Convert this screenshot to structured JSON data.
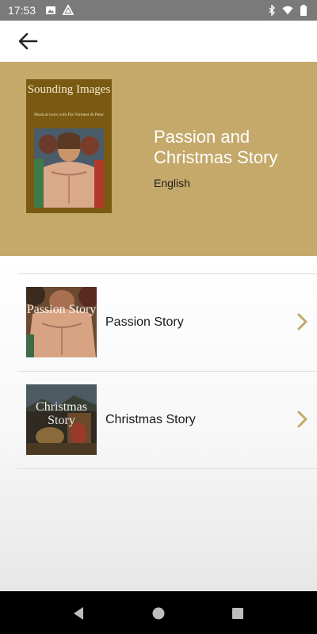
{
  "status_bar": {
    "time": "17:53",
    "left_icons": [
      "image-icon",
      "drive-icon"
    ],
    "right_icons": [
      "bluetooth-icon",
      "wifi-icon",
      "battery-icon"
    ]
  },
  "app_bar": {
    "back_icon": "arrow-left-icon"
  },
  "hero": {
    "background_color": "#c4a96a",
    "cover": {
      "title": "Sounding Images",
      "subtitle": "Musical tours with Pia Vermeer & Peter"
    },
    "title": "Passion and Christmas Story",
    "language": "English"
  },
  "list": {
    "items": [
      {
        "label": "Passion Story",
        "thumb_text": "Passion Story",
        "icon": "chevron-right-icon"
      },
      {
        "label": "Christmas Story",
        "thumb_text": "Christmas Story",
        "icon": "chevron-right-icon"
      }
    ]
  },
  "accent_color": "#c4a96a",
  "nav_bar": {
    "buttons": [
      "back-triangle-icon",
      "home-circle-icon",
      "recents-square-icon"
    ]
  }
}
